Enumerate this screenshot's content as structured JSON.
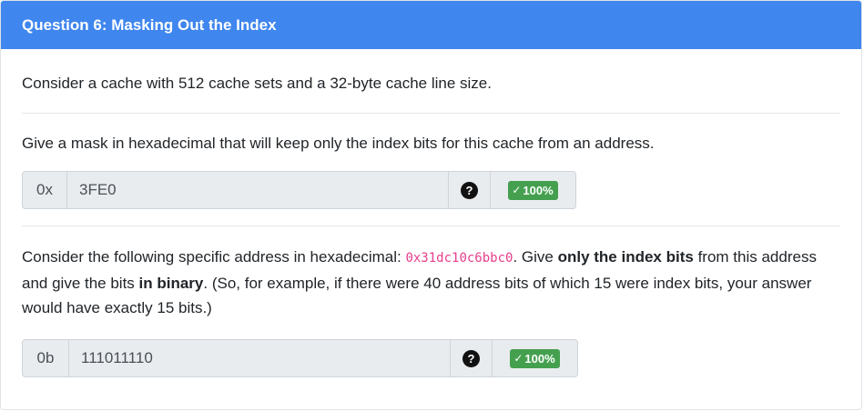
{
  "header": {
    "title": "Question 6: Masking Out the Index"
  },
  "intro": {
    "text": "Consider a cache with 512 cache sets and a 32-byte cache line size."
  },
  "part1": {
    "prompt": "Give a mask in hexadecimal that will keep only the index bits for this cache from an address.",
    "prefix": "0x",
    "value": "3FE0",
    "help_icon": "question-circle-icon",
    "check_icon": "check-icon",
    "score": "100%"
  },
  "part2": {
    "text_a": "Consider the following specific address in hexadecimal: ",
    "address": "0x31dc10c6bbc0",
    "text_b": ". Give ",
    "bold_a": "only the index bits",
    "text_c": " from this address and give the bits ",
    "bold_b": "in binary",
    "text_d": ". (So, for example, if there were 40 address bits of which 15 were index bits, your answer would have exactly 15 bits.)",
    "prefix": "0b",
    "value": "111011110",
    "help_icon": "question-circle-icon",
    "check_icon": "check-icon",
    "score": "100%"
  },
  "colors": {
    "header_bg": "#3f86ee",
    "badge_green": "#44a04f",
    "code_pink": "#e83e8c",
    "input_bg": "#e9ecef"
  }
}
